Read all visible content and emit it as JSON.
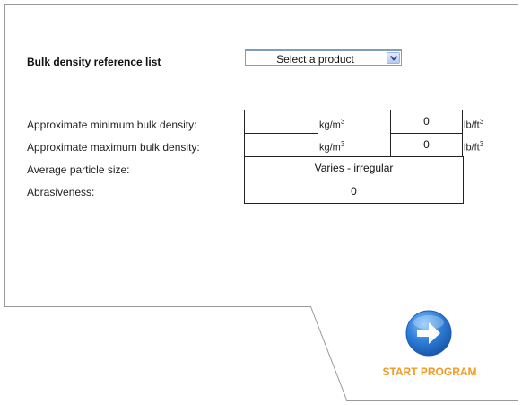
{
  "heading": "Bulk density reference list",
  "product_select": {
    "value": "Select a product"
  },
  "rows": {
    "min_density": {
      "label": "Approximate minimum bulk density:",
      "kg_value": "",
      "kg_unit": "kg/m",
      "kg_exp": "3",
      "lb_value": "0",
      "lb_unit": "lb/ft",
      "lb_exp": "3"
    },
    "max_density": {
      "label": "Approximate maximum bulk density:",
      "kg_value": "",
      "kg_unit": "kg/m",
      "kg_exp": "3",
      "lb_value": "0",
      "lb_unit": "lb/ft",
      "lb_exp": "3"
    },
    "particle_size": {
      "label": "Average particle size:",
      "value": "Varies - irregular"
    },
    "abrasiveness": {
      "label": "Abrasiveness:",
      "value": "0"
    }
  },
  "start_button": {
    "label": "START PROGRAM",
    "icon": "arrow-right-circle-icon",
    "color": "#f29b24",
    "icon_color": "#2f7fd8"
  },
  "frame_border_color": "#9a9a9a"
}
